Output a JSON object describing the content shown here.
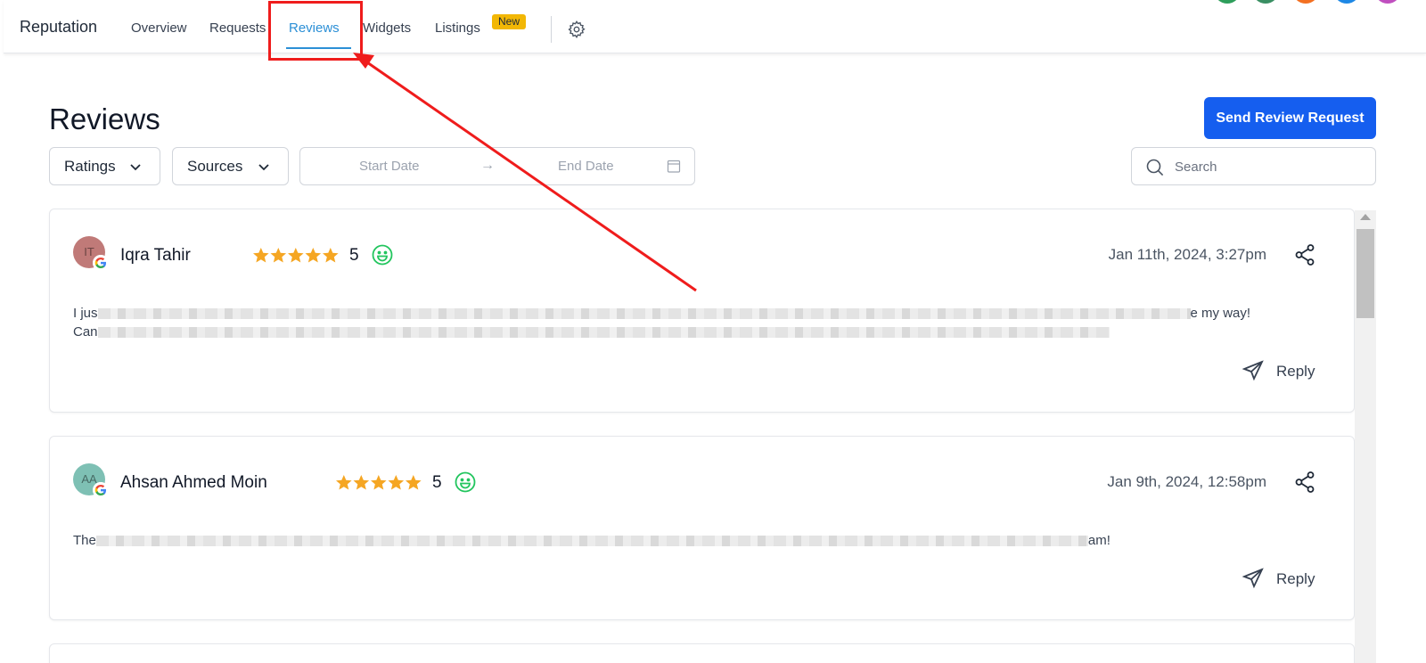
{
  "app": {
    "brand": "Reputation",
    "tabs": [
      {
        "label": "Overview"
      },
      {
        "label": "Requests"
      },
      {
        "label": "Reviews"
      },
      {
        "label": "Widgets"
      },
      {
        "label": "Listings"
      }
    ],
    "active_tab": "Reviews",
    "new_badge": "New",
    "settings_icon": "gear-icon"
  },
  "page": {
    "title": "Reviews",
    "send_button": "Send Review Request"
  },
  "filters": {
    "ratings": "Ratings",
    "sources": "Sources",
    "start_date_placeholder": "Start Date",
    "end_date_placeholder": "End Date",
    "arrow": "→",
    "search_placeholder": "Search"
  },
  "reviews": [
    {
      "initials": "IT",
      "avatar_color": "#c07a78",
      "name": "Iqra Tahir",
      "stars": 5,
      "rating": "5",
      "date": "Jan 11th, 2024, 3:27pm",
      "line1_start": "I jus",
      "line1_end": "e my way!",
      "line2_start": "Can",
      "reply": "Reply"
    },
    {
      "initials": "AA",
      "avatar_color": "#7ec0b4",
      "name": "Ahsan Ahmed Moin",
      "stars": 5,
      "rating": "5",
      "date": "Jan 9th, 2024, 12:58pm",
      "line1_start": "The",
      "line1_end": "am!",
      "reply": "Reply"
    }
  ],
  "colors": {
    "accent": "#2b8fd6",
    "primary": "#155eef",
    "star": "#f5a623",
    "smiley": "#22c55e",
    "annotation": "#ef1c1c"
  }
}
